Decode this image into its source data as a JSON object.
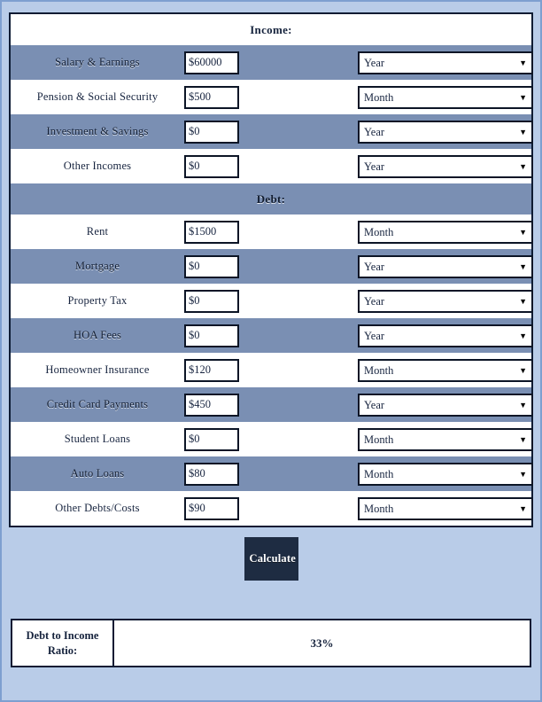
{
  "theme": {
    "page_background": "#b9cce8",
    "page_border": "#7e9fd0",
    "row_alt_background": "#7a8fb3",
    "row_plain_background": "#ffffff",
    "text_color": "#17243f",
    "button_background": "#1e2c42",
    "button_text": "#ffffff",
    "field_border": "#0c1526"
  },
  "sections": [
    {
      "key": "income",
      "header": "Income:",
      "header_row_style": "plain",
      "rows": [
        {
          "label": "Salary & Earnings",
          "amount": "$60000",
          "period": "Year",
          "row_style": "alt"
        },
        {
          "label": "Pension & Social Security",
          "amount": "$500",
          "period": "Month",
          "row_style": "plain"
        },
        {
          "label": "Investment & Savings",
          "amount": "$0",
          "period": "Year",
          "row_style": "alt"
        },
        {
          "label": "Other Incomes",
          "amount": "$0",
          "period": "Year",
          "row_style": "plain"
        }
      ]
    },
    {
      "key": "debt",
      "header": "Debt:",
      "header_row_style": "alt",
      "rows": [
        {
          "label": "Rent",
          "amount": "$1500",
          "period": "Month",
          "row_style": "plain"
        },
        {
          "label": "Mortgage",
          "amount": "$0",
          "period": "Year",
          "row_style": "alt"
        },
        {
          "label": "Property Tax",
          "amount": "$0",
          "period": "Year",
          "row_style": "plain"
        },
        {
          "label": "HOA Fees",
          "amount": "$0",
          "period": "Year",
          "row_style": "alt"
        },
        {
          "label": "Homeowner Insurance",
          "amount": "$120",
          "period": "Month",
          "row_style": "plain"
        },
        {
          "label": "Credit Card Payments",
          "amount": "$450",
          "period": "Year",
          "row_style": "alt"
        },
        {
          "label": "Student Loans",
          "amount": "$0",
          "period": "Month",
          "row_style": "plain"
        },
        {
          "label": "Auto Loans",
          "amount": "$80",
          "period": "Month",
          "row_style": "alt"
        },
        {
          "label": "Other Debts/Costs",
          "amount": "$90",
          "period": "Month",
          "row_style": "plain"
        }
      ]
    }
  ],
  "period_options": [
    "Year",
    "Month"
  ],
  "amount_placeholder": "$0",
  "calculate": {
    "label": "Calculate"
  },
  "result": {
    "label": "Debt to Income Ratio:",
    "label_line1": "Debt to Income",
    "label_line2": "Ratio:",
    "value": "33%"
  },
  "icons": {
    "select_arrow": "chevron-down-icon",
    "arrow_glyph": "▼"
  }
}
